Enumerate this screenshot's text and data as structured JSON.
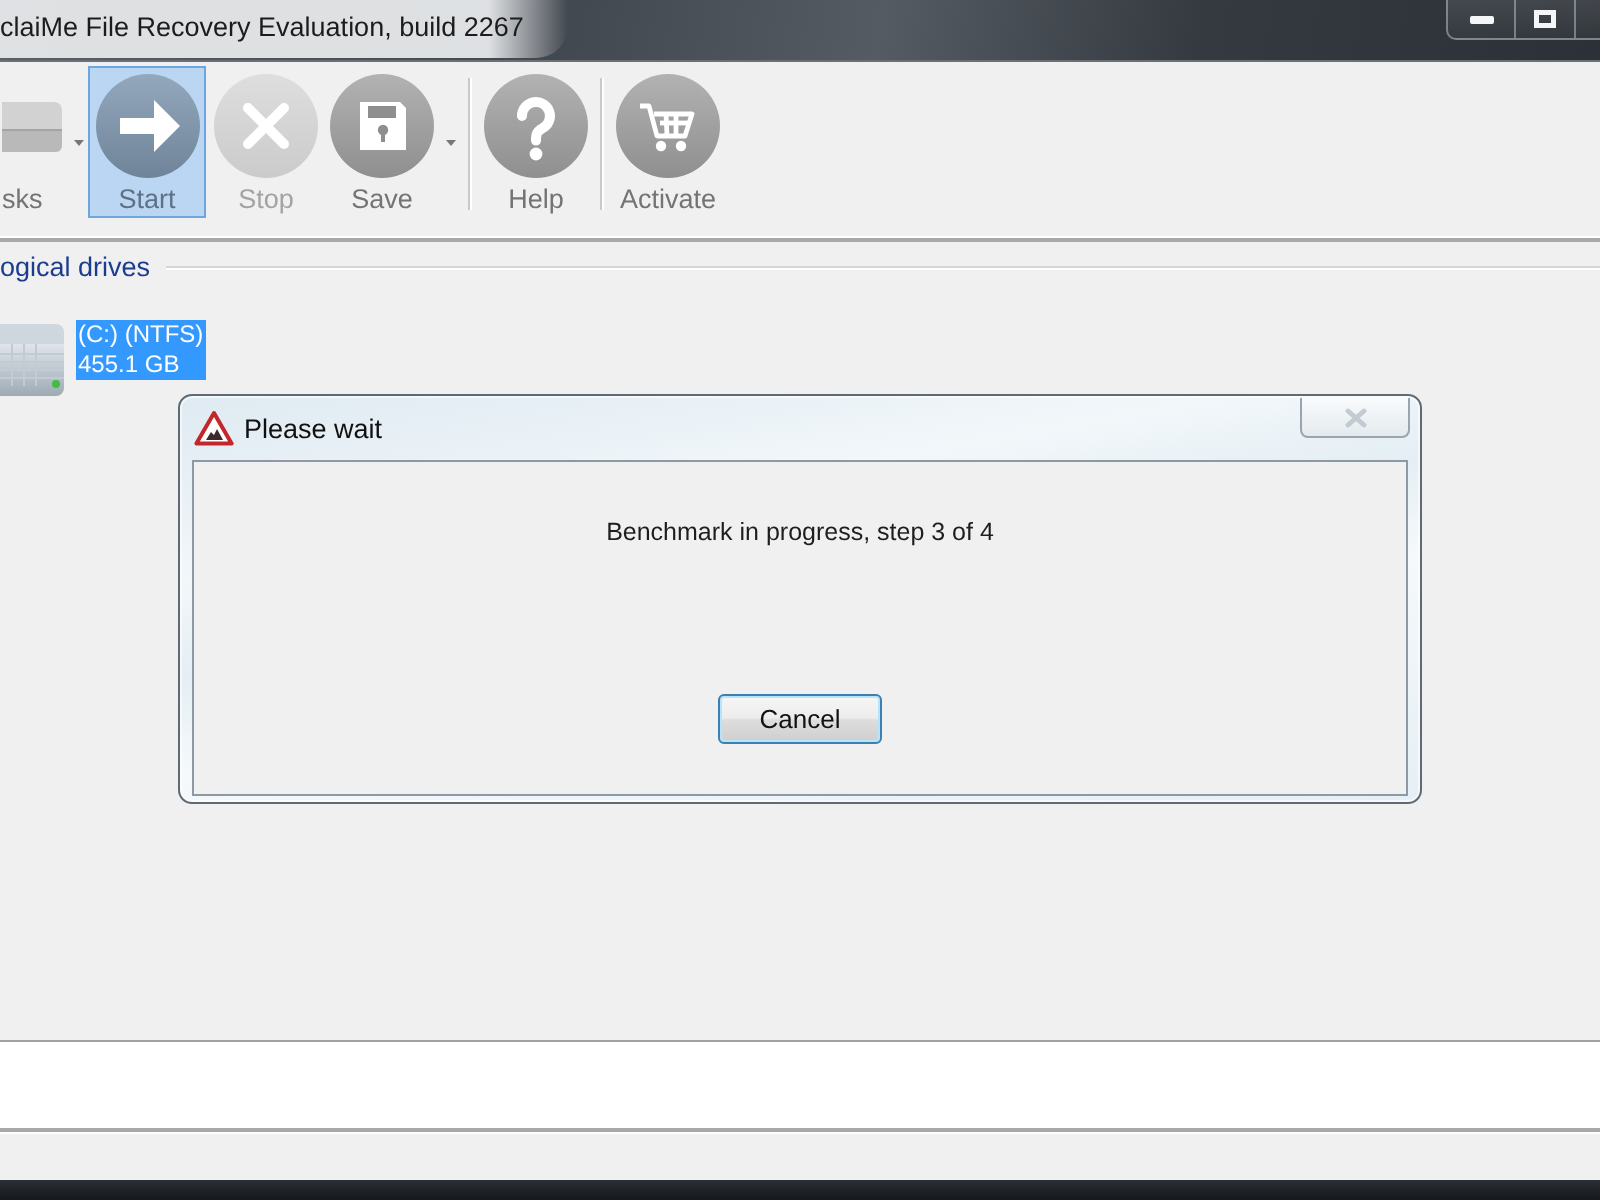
{
  "window": {
    "title": "claiMe File Recovery Evaluation, build 2267"
  },
  "toolbar": {
    "items": [
      {
        "label": "sks",
        "highlighted": false,
        "disabled": false,
        "dropdown": true,
        "separator_before": false
      },
      {
        "label": "Start",
        "highlighted": true,
        "disabled": false,
        "dropdown": false,
        "separator_before": false
      },
      {
        "label": "Stop",
        "highlighted": false,
        "disabled": true,
        "dropdown": false,
        "separator_before": false
      },
      {
        "label": "Save",
        "highlighted": false,
        "disabled": false,
        "dropdown": true,
        "separator_before": false
      },
      {
        "label": "Help",
        "highlighted": false,
        "disabled": false,
        "dropdown": false,
        "separator_before": true
      },
      {
        "label": "Activate",
        "highlighted": false,
        "disabled": false,
        "dropdown": false,
        "separator_before": true
      }
    ]
  },
  "drives": {
    "group_label": "ogical drives",
    "items": [
      {
        "name": "(C:) (NTFS)",
        "size": "455.1 GB",
        "selected": true
      }
    ]
  },
  "dialog": {
    "title": "Please wait",
    "close_disabled": true,
    "message": "Benchmark in progress, step 3 of 4",
    "buttons": [
      "Cancel"
    ]
  }
}
